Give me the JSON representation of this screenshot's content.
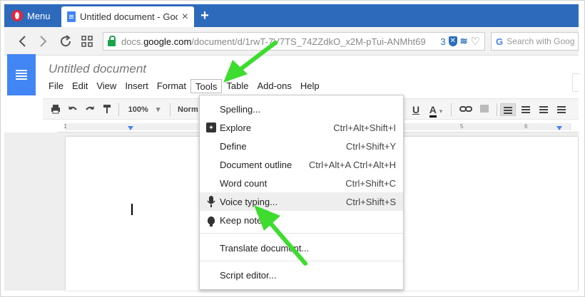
{
  "browser": {
    "menu_label": "Menu",
    "tab_title": "Untitled document - Goog",
    "tab_close": "×",
    "new_tab": "+",
    "url_prefix": "docs.",
    "url_host": "google.com",
    "url_path": "/document/d/1rwT-7V7TS_74ZZdkO_x2M-pTui-ANMht69",
    "url_badge": "3",
    "search_placeholder": "Search with Goog",
    "search_provider_glyph": "G",
    "icons": [
      "opera-logo-icon",
      "docs-favicon-icon",
      "back-icon",
      "forward-icon",
      "reload-icon",
      "speed-dial-icon",
      "lock-icon",
      "shield-icon",
      "stack-icon",
      "heart-icon"
    ]
  },
  "doc": {
    "title": "Untitled document",
    "menu": [
      "File",
      "Edit",
      "View",
      "Insert",
      "Format",
      "Tools",
      "Table",
      "Add-ons",
      "Help"
    ],
    "active_menu": "Tools"
  },
  "toolbar": {
    "zoom": "100%",
    "zoom_caret": "▾",
    "style": "Norm",
    "underline": "U",
    "text_color": "A",
    "color_caret": "▾"
  },
  "ruler": {
    "labels": [
      "1",
      "1",
      "5",
      "6"
    ]
  },
  "tools_menu": {
    "items": [
      {
        "label": "Spelling...",
        "shortcut": "",
        "icon": ""
      },
      {
        "label": "Explore",
        "shortcut": "Ctrl+Alt+Shift+I",
        "icon": "explore-icon"
      },
      {
        "label": "Define",
        "shortcut": "Ctrl+Shift+Y",
        "icon": ""
      },
      {
        "label": "Document outline",
        "shortcut": "Ctrl+Alt+A Ctrl+Alt+H",
        "icon": ""
      },
      {
        "label": "Word count",
        "shortcut": "Ctrl+Shift+C",
        "icon": ""
      },
      {
        "label": "Voice typing...",
        "shortcut": "Ctrl+Shift+S",
        "icon": "microphone-icon",
        "highlighted": true
      },
      {
        "label": "Keep note",
        "shortcut": "",
        "icon": "lightbulb-icon"
      },
      {
        "label": "Translate document...",
        "shortcut": "",
        "icon": ""
      },
      {
        "label": "Script editor...",
        "shortcut": "",
        "icon": ""
      }
    ]
  },
  "annotation_color": "#3ddc2e",
  "accent_color": "#4285f4",
  "browser_color": "#2d6abc"
}
